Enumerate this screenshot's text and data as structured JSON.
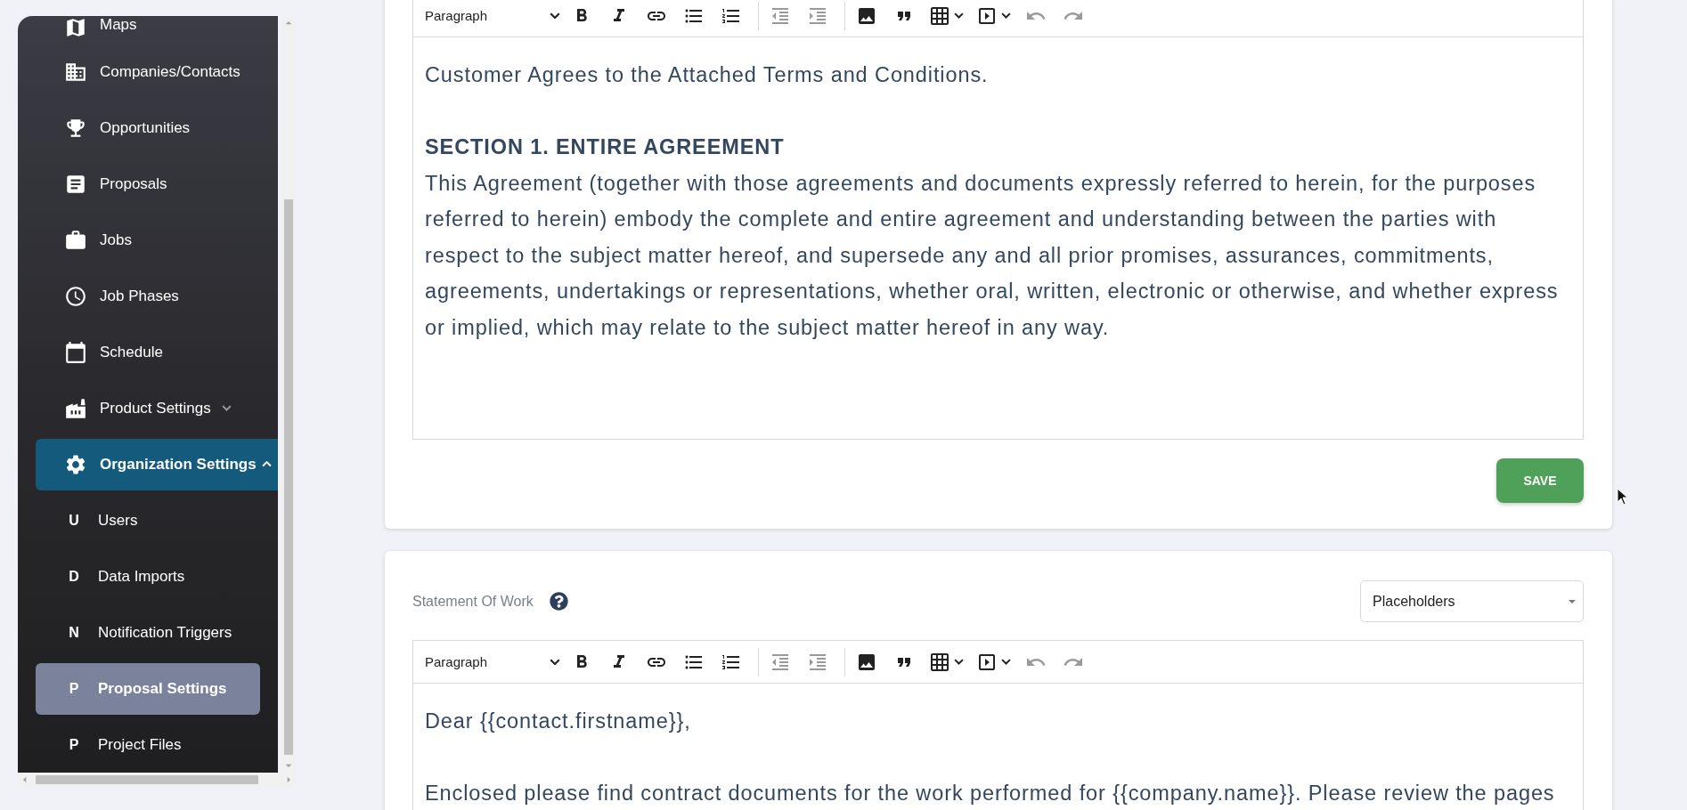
{
  "sidebar": {
    "items": [
      {
        "label": "Maps",
        "selected": false
      },
      {
        "label": "Companies/Contacts",
        "selected": false
      },
      {
        "label": "Opportunities",
        "selected": false
      },
      {
        "label": "Proposals",
        "selected": false
      },
      {
        "label": "Jobs",
        "selected": false
      },
      {
        "label": "Job Phases",
        "selected": false
      },
      {
        "label": "Schedule",
        "selected": false
      },
      {
        "label": "Product Settings",
        "selected": false,
        "expanded": false
      },
      {
        "label": "Organization Settings",
        "selected": true,
        "expanded": true,
        "children": [
          {
            "badge": "U",
            "label": "Users",
            "selected": false
          },
          {
            "badge": "D",
            "label": "Data Imports",
            "selected": false
          },
          {
            "badge": "N",
            "label": "Notification Triggers",
            "selected": false
          },
          {
            "badge": "P",
            "label": "Proposal Settings",
            "selected": true
          },
          {
            "badge": "P",
            "label": "Project Files",
            "selected": false
          }
        ]
      }
    ]
  },
  "cards": [
    {
      "editor": {
        "toolbar": {
          "block_format": "Paragraph",
          "buttons": [
            {
              "disabled": false
            },
            {
              "disabled": false
            },
            {
              "disabled": false
            },
            {
              "disabled": false
            },
            {
              "disabled": false
            },
            {
              "disabled": true
            },
            {
              "disabled": true
            },
            {
              "disabled": false
            },
            {
              "disabled": false
            },
            {
              "disabled": false
            },
            {
              "disabled": false
            },
            {
              "disabled": true
            },
            {
              "disabled": true
            }
          ]
        },
        "paragraphs": [
          {
            "kind": "text",
            "text": "Customer Agrees to the Attached Terms and Conditions."
          },
          {
            "kind": "heading",
            "text": "SECTION 1. ENTIRE AGREEMENT"
          },
          {
            "kind": "text",
            "text": "This Agreement (together with those agreements and documents expressly referred to herein, for the purposes referred to herein) embody the complete and entire agreement and understanding between the parties with respect to the subject matter hereof, and supersede any and all prior promises, assurances, commitments, agreements, undertakings or representations, whether oral, written, electronic or otherwise, and whether express or implied, which may relate to the subject matter hereof in any way."
          }
        ]
      },
      "save_button": "SAVE"
    },
    {
      "label": "Statement Of Work",
      "select": "Placeholders",
      "editor": {
        "toolbar": {
          "block_format": "Paragraph",
          "buttons": [
            {
              "disabled": false
            },
            {
              "disabled": false
            },
            {
              "disabled": false
            },
            {
              "disabled": false
            },
            {
              "disabled": false
            },
            {
              "disabled": true
            },
            {
              "disabled": true
            },
            {
              "disabled": false
            },
            {
              "disabled": false
            },
            {
              "disabled": false
            },
            {
              "disabled": false
            },
            {
              "disabled": true
            },
            {
              "disabled": true
            }
          ]
        },
        "paragraphs": [
          {
            "kind": "text",
            "text": "Dear {{contact.firstname}},"
          },
          {
            "kind": "text",
            "text": "Enclosed please find contract documents for the work performed for {{company.name}}. Please review the pages"
          }
        ]
      }
    }
  ]
}
